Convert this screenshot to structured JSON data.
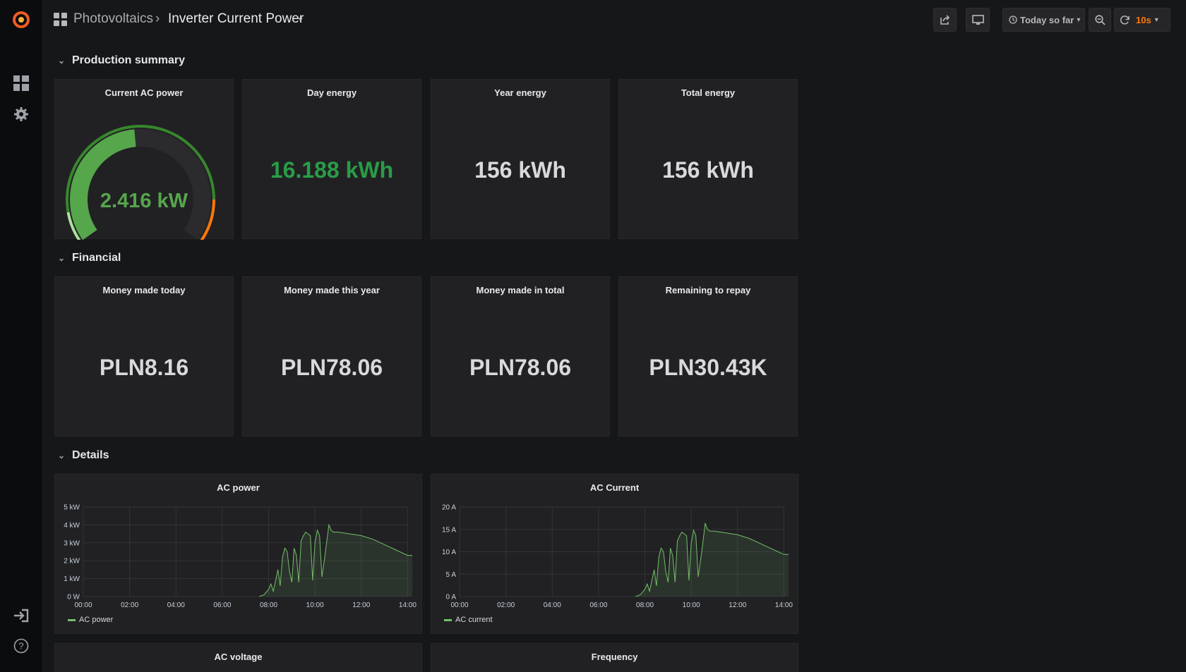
{
  "breadcrumb": {
    "folder": "Photovoltaics",
    "separator": "›",
    "dashboard": "Inverter Current Power",
    "caret": "▾"
  },
  "toolbar": {
    "time_range": "Today so far",
    "refresh_interval": "10s",
    "caret": "▾"
  },
  "colors": {
    "accent_green": "#299c46",
    "series_green": "#73bf69",
    "refresh_orange": "#ff780a",
    "gauge_orange": "#ff780a"
  },
  "rows": [
    {
      "title": "Production summary"
    },
    {
      "title": "Financial"
    },
    {
      "title": "Details"
    }
  ],
  "production": {
    "gauge": {
      "title": "Current AC power",
      "value": "2.416 kW",
      "level": 0.48
    },
    "stats": [
      {
        "title": "Day energy",
        "value": "16.188 kWh"
      },
      {
        "title": "Year energy",
        "value": "156 kWh"
      },
      {
        "title": "Total energy",
        "value": "156 kWh"
      }
    ]
  },
  "financial": {
    "stats": [
      {
        "title": "Money made today",
        "value": "PLN8.16"
      },
      {
        "title": "Money made this year",
        "value": "PLN78.06"
      },
      {
        "title": "Money made in total",
        "value": "PLN78.06"
      },
      {
        "title": "Remaining to repay",
        "value": "PLN30.43K"
      }
    ]
  },
  "details": {
    "bottom_panels": [
      {
        "title": "AC voltage"
      },
      {
        "title": "Frequency"
      }
    ]
  },
  "chart_data": [
    {
      "type": "area",
      "title": "AC power",
      "legend": "AC power",
      "xticks": [
        "00:00",
        "02:00",
        "04:00",
        "06:00",
        "08:00",
        "10:00",
        "12:00",
        "14:00"
      ],
      "yticks": [
        "0 W",
        "1 kW",
        "2 kW",
        "3 kW",
        "4 kW",
        "5 kW"
      ],
      "xlim": [
        0,
        14.2
      ],
      "ylim": [
        0,
        5
      ],
      "x": [
        7.6,
        7.8,
        8.0,
        8.1,
        8.2,
        8.3,
        8.4,
        8.5,
        8.6,
        8.7,
        8.8,
        8.9,
        9.0,
        9.1,
        9.2,
        9.3,
        9.4,
        9.5,
        9.6,
        9.7,
        9.8,
        9.9,
        10.0,
        10.1,
        10.2,
        10.3,
        10.4,
        10.5,
        10.6,
        10.7,
        10.8,
        10.9,
        11.0,
        11.5,
        12.0,
        12.5,
        13.0,
        13.5,
        14.0,
        14.2
      ],
      "y": [
        0,
        0.1,
        0.4,
        0.7,
        0.3,
        0.9,
        1.5,
        0.6,
        2.2,
        2.7,
        2.5,
        1.4,
        0.8,
        2.7,
        2.3,
        0.8,
        3.1,
        3.4,
        3.6,
        3.5,
        3.4,
        0.9,
        3.0,
        3.7,
        3.4,
        1.1,
        2.0,
        3.0,
        4.0,
        3.7,
        3.6,
        3.6,
        3.6,
        3.5,
        3.4,
        3.2,
        2.9,
        2.6,
        2.3,
        2.3
      ]
    },
    {
      "type": "area",
      "title": "AC Current",
      "legend": "AC current",
      "xticks": [
        "00:00",
        "02:00",
        "04:00",
        "06:00",
        "08:00",
        "10:00",
        "12:00",
        "14:00"
      ],
      "yticks": [
        "0 A",
        "5 A",
        "10 A",
        "15 A",
        "20 A"
      ],
      "xlim": [
        0,
        14.2
      ],
      "ylim": [
        0,
        20
      ],
      "x": [
        7.6,
        7.8,
        8.0,
        8.1,
        8.2,
        8.3,
        8.4,
        8.5,
        8.6,
        8.7,
        8.8,
        8.9,
        9.0,
        9.1,
        9.2,
        9.3,
        9.4,
        9.5,
        9.6,
        9.7,
        9.8,
        9.9,
        10.0,
        10.1,
        10.2,
        10.3,
        10.4,
        10.5,
        10.6,
        10.7,
        10.8,
        10.9,
        11.0,
        11.5,
        12.0,
        12.5,
        13.0,
        13.5,
        14.0,
        14.2
      ],
      "y": [
        0,
        0.4,
        1.6,
        2.8,
        1.2,
        3.6,
        6,
        2.4,
        8.8,
        10.8,
        10,
        5.6,
        3.2,
        10.8,
        9.2,
        3.2,
        12.4,
        13.6,
        14.4,
        14,
        13.6,
        3.6,
        12,
        14.8,
        13.6,
        4.4,
        8,
        12,
        16.4,
        15,
        14.6,
        14.6,
        14.6,
        14.2,
        13.8,
        13,
        11.8,
        10.6,
        9.4,
        9.4
      ]
    }
  ]
}
